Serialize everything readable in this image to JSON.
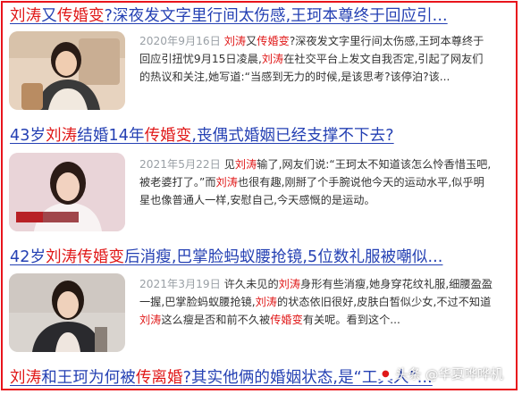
{
  "results": [
    {
      "title_parts": [
        {
          "text": "刘涛",
          "hl": true
        },
        {
          "text": "又",
          "hl": false
        },
        {
          "text": "传婚变",
          "hl": true
        },
        {
          "text": "?深夜发文字里行间太伤感,王珂本尊终于回应引...",
          "hl": false
        }
      ],
      "date": "2020年9月16日",
      "snippet_parts": [
        {
          "text": "刘涛",
          "hl": true
        },
        {
          "text": "又",
          "hl": false
        },
        {
          "text": "传婚变",
          "hl": true
        },
        {
          "text": "?深夜发文字里行间太伤感,王珂本尊终于回应引扭忧9月15日凌晨,",
          "hl": false
        },
        {
          "text": "刘涛",
          "hl": true
        },
        {
          "text": "在社交平台上发文自我否定,引起了网友们的热议和关注,她写道:“当感到无力的时候,是该思考?该停泊?该...",
          "hl": false
        }
      ]
    },
    {
      "title_parts": [
        {
          "text": "43岁",
          "hl": false
        },
        {
          "text": "刘涛",
          "hl": true
        },
        {
          "text": "结婚14年",
          "hl": false
        },
        {
          "text": "传婚变",
          "hl": true
        },
        {
          "text": ",丧偶式婚姻已经支撑不下去?",
          "hl": false
        }
      ],
      "date": "2021年5月22日",
      "snippet_parts": [
        {
          "text": "见",
          "hl": false
        },
        {
          "text": "刘涛",
          "hl": true
        },
        {
          "text": "输了,网友们说:“王珂太不知道该怎么怜香惜玉吧,被老婆打了。”而",
          "hl": false
        },
        {
          "text": "刘涛",
          "hl": true
        },
        {
          "text": "也很有趣,刚掰了个手腕说他今天的运动水平,似乎明星也像普通人一样,安慰自己,今天感慨的是运动。",
          "hl": false
        }
      ]
    },
    {
      "title_parts": [
        {
          "text": "42岁",
          "hl": false
        },
        {
          "text": "刘涛",
          "hl": true
        },
        {
          "text": "传婚变",
          "hl": true
        },
        {
          "text": "后消瘦,巴掌脸蚂蚁腰抢镜,5位数礼服被嘲似...",
          "hl": false
        }
      ],
      "date": "2021年3月19日",
      "snippet_parts": [
        {
          "text": "许久未见的",
          "hl": false
        },
        {
          "text": "刘涛",
          "hl": true
        },
        {
          "text": "身形有些消瘦,她身穿花纹礼服,细腰盈盈一握,巴掌脸蚂蚁腰抢镜,",
          "hl": false
        },
        {
          "text": "刘涛",
          "hl": true
        },
        {
          "text": "的状态依旧很好,皮肤白皙似少女,不过不知道",
          "hl": false
        },
        {
          "text": "刘涛",
          "hl": true
        },
        {
          "text": "这么瘦是否和前不久被",
          "hl": false
        },
        {
          "text": "传婚变",
          "hl": true
        },
        {
          "text": "有关呢。看到这个...",
          "hl": false
        }
      ]
    },
    {
      "title_parts": [
        {
          "text": "刘涛",
          "hl": true
        },
        {
          "text": "和王珂为何被",
          "hl": false
        },
        {
          "text": "传离婚",
          "hl": true
        },
        {
          "text": "?其实他俩的婚姻状态,是“工具人”...",
          "hl": false
        }
      ]
    }
  ],
  "watermark": {
    "text": "头条 @华夏哗哗机"
  },
  "colors": {
    "link": "#2440b3",
    "highlight": "#e01818",
    "date": "#9aa0a6",
    "border": "#e8141c"
  }
}
